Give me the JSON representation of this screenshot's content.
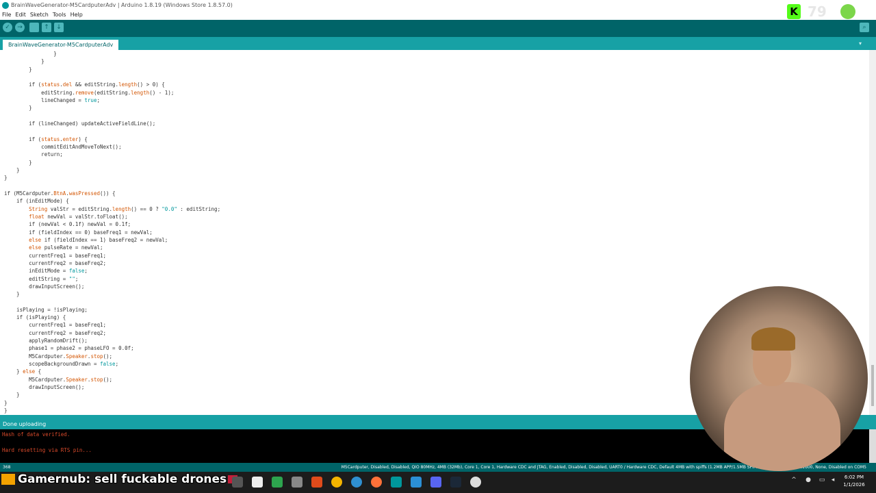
{
  "window": {
    "title": "BrainWaveGenerator-M5CardputerAdv | Arduino 1.8.19 (Windows Store 1.8.57.0)"
  },
  "menu": [
    "File",
    "Edit",
    "Sketch",
    "Tools",
    "Help"
  ],
  "toolbar": {
    "buttons": [
      "verify-icon",
      "upload-icon",
      "new-icon",
      "open-icon",
      "save-icon"
    ],
    "right": "serial-monitor-icon"
  },
  "tab": {
    "label": "BrainWaveGenerator-M5CardputerAdv"
  },
  "code": {
    "lines": [
      "                }",
      "            }",
      "        }",
      "",
      "        if (status.del && editString.length() > 0) {",
      "            editString.remove(editString.length() - 1);",
      "            lineChanged = true;",
      "        }",
      "",
      "        if (lineChanged) updateActiveFieldLine();",
      "",
      "        if (status.enter) {",
      "            commitEditAndMoveToNext();",
      "            return;",
      "        }",
      "    }",
      "}",
      "",
      "if (M5Cardputer.BtnA.wasPressed()) {",
      "    if (inEditMode) {",
      "        String valStr = editString.length() == 0 ? \"0.0\" : editString;",
      "        float newVal = valStr.toFloat();",
      "        if (newVal < 0.1f) newVal = 0.1f;",
      "        if (fieldIndex == 0) baseFreq1 = newVal;",
      "        else if (fieldIndex == 1) baseFreq2 = newVal;",
      "        else pulseRate = newVal;",
      "        currentFreq1 = baseFreq1;",
      "        currentFreq2 = baseFreq2;",
      "        inEditMode = false;",
      "        editString = \"\";",
      "        drawInputScreen();",
      "    }",
      "",
      "    isPlaying = !isPlaying;",
      "    if (isPlaying) {",
      "        currentFreq1 = baseFreq1;",
      "        currentFreq2 = baseFreq2;",
      "        applyRandomDrift();",
      "        phase1 = phase2 = phaseLFO = 0.0f;",
      "        M5Cardputer.Speaker.stop();",
      "        scopeBackgroundDrawn = false;",
      "    } else {",
      "        M5Cardputer.Speaker.stop();",
      "        drawInputScreen();",
      "    }",
      "}",
      "}",
      ""
    ]
  },
  "status": {
    "message": "Done uploading"
  },
  "console": {
    "lines": [
      "Hash of data verified.",
      "",
      "Hard resetting via RTS pin..."
    ]
  },
  "boardbar": {
    "line_number": "368",
    "board_info": "M5Cardputer, Disabled, Disabled, QIO 80MHz, 4MB (32Mb), Core 1, Core 1, Hardware CDC and JTAG, Enabled, Disabled, Disabled, UART0 / Hardware CDC, Default 4MB with spiffs (1.2MB APP/1.5MB SPIFFS), 240MHz (WiFi), 921600, None, Disabled on COM5"
  },
  "stream_overlay": {
    "ticker": "Gamernub: sell fuckable drones",
    "counter": "79"
  },
  "taskbar": {
    "time": "6:02 PM",
    "date": "1/1/2026"
  },
  "colors": {
    "teal_dark": "#006468",
    "teal": "#17a1a5",
    "keyword": "#d35400",
    "literal": "#00979c"
  }
}
